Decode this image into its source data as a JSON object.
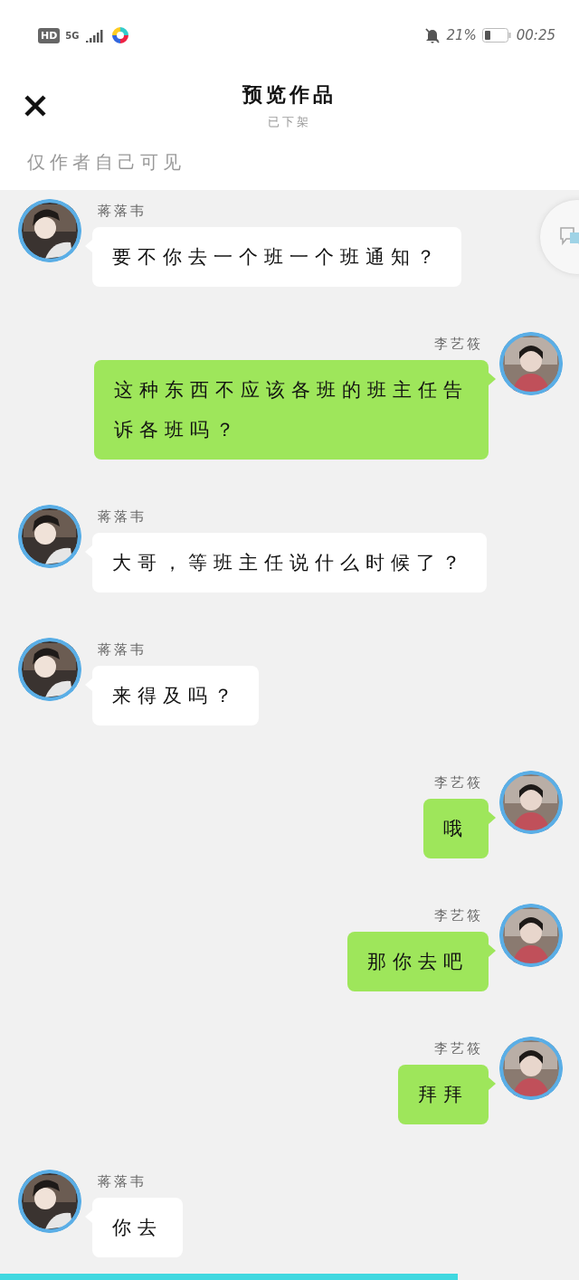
{
  "status_bar": {
    "badges": [
      "HD",
      "5G"
    ],
    "battery_percent": "21%",
    "time": "00:25"
  },
  "header": {
    "title": "预览作品",
    "subtitle": "已下架"
  },
  "visibility_note": "仅作者自己可见",
  "messages": [
    {
      "kind": "incoming",
      "sender": "蒋落韦",
      "text": "要不你去一个班一个班通知？"
    },
    {
      "kind": "outgoing",
      "sender": "李艺筱",
      "text": "这种东西不应该各班的班主任告诉各班吗？"
    },
    {
      "kind": "incoming",
      "sender": "蒋落韦",
      "text": "大哥，等班主任说什么时候了？"
    },
    {
      "kind": "incoming",
      "sender": "蒋落韦",
      "text": "来得及吗？"
    },
    {
      "kind": "outgoing",
      "sender": "李艺筱",
      "text": "哦"
    },
    {
      "kind": "outgoing",
      "sender": "李艺筱",
      "text": "那你去吧"
    },
    {
      "kind": "outgoing",
      "sender": "李艺筱",
      "text": "拜拜"
    },
    {
      "kind": "incoming",
      "sender": "蒋落韦",
      "text": "你去"
    }
  ],
  "progress": {
    "level": 0.79
  }
}
